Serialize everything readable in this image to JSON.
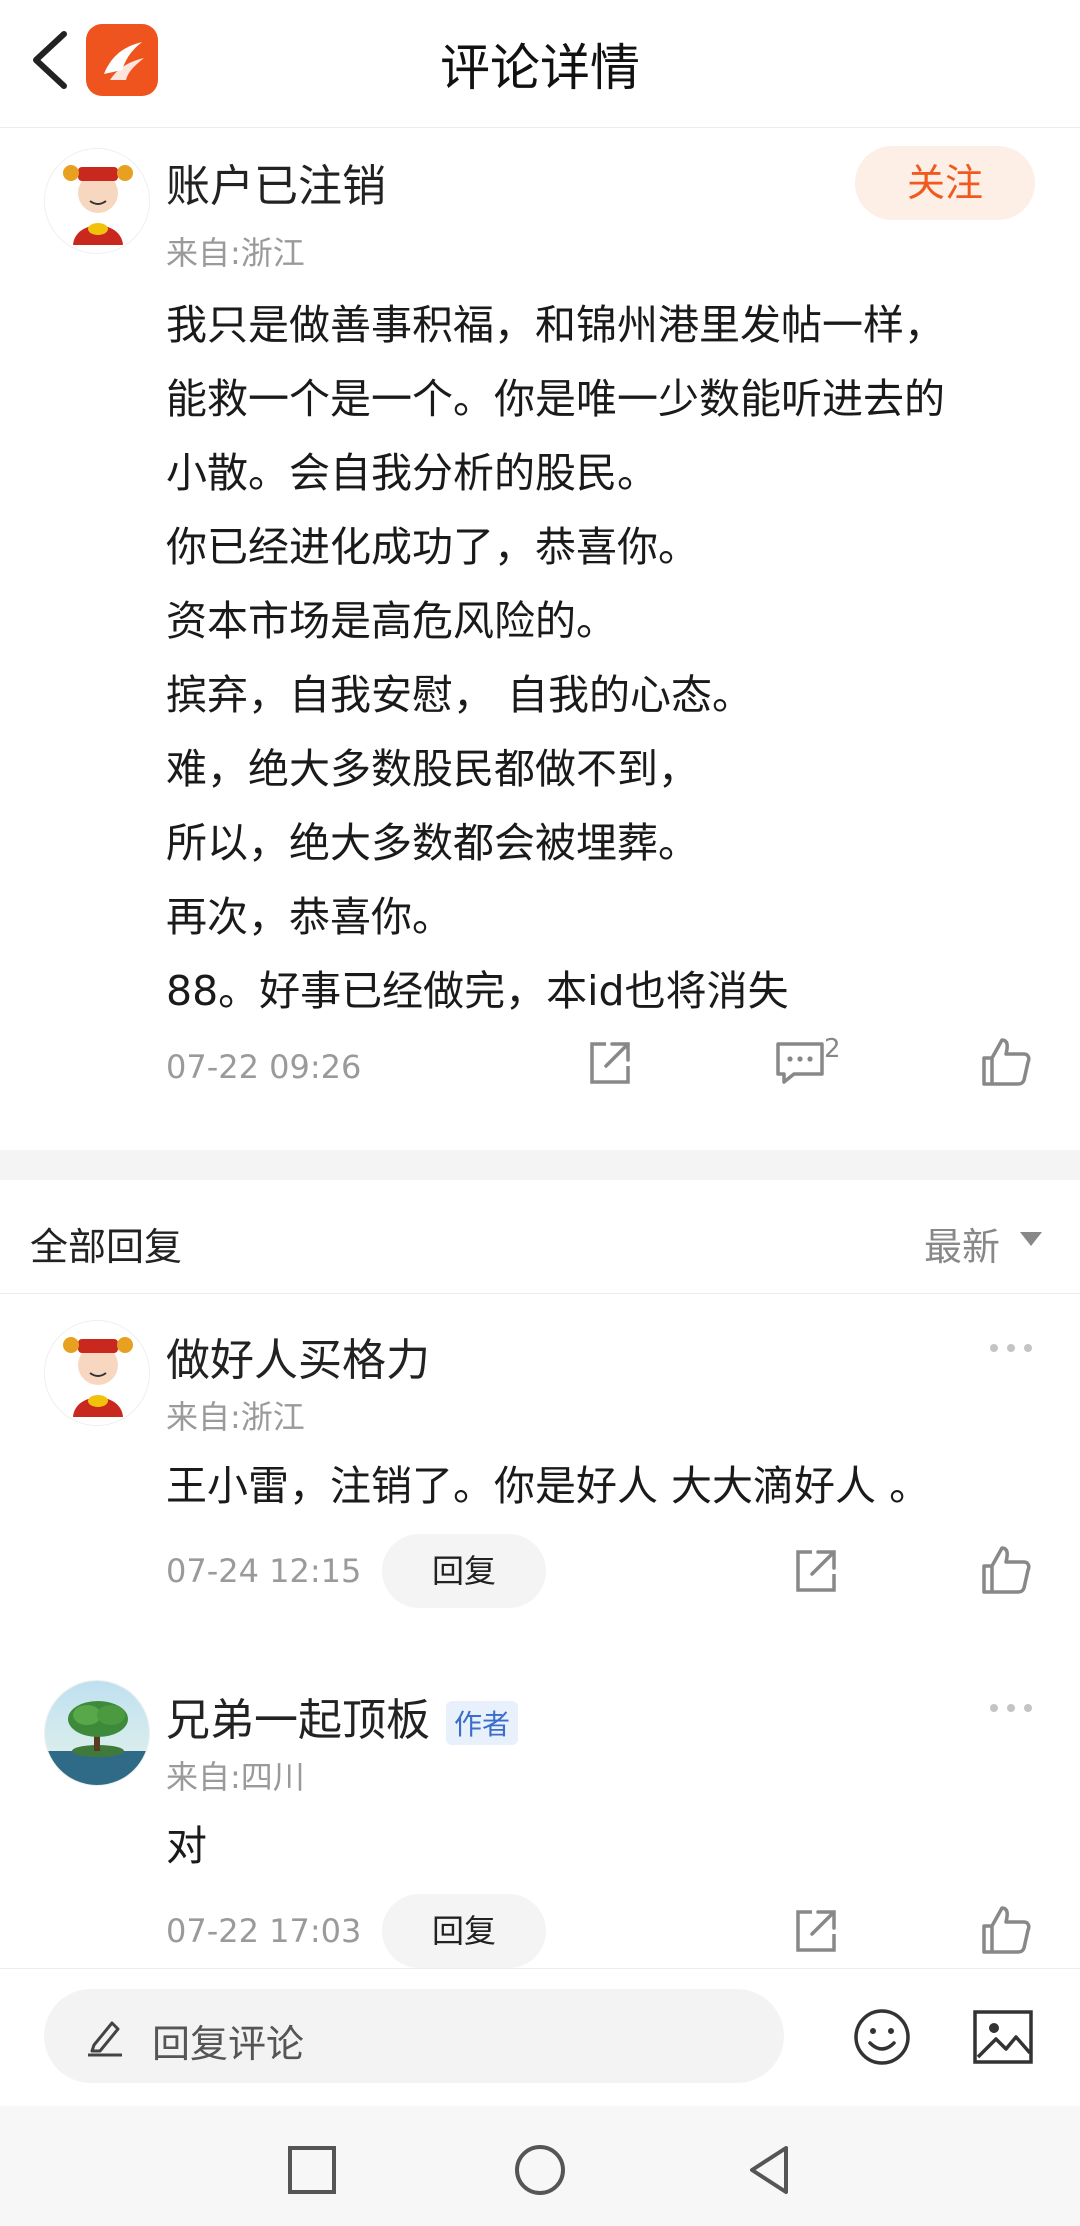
{
  "header": {
    "title": "评论详情"
  },
  "main_comment": {
    "username": "账户已注销",
    "origin": "来自:浙江",
    "follow_label": "关注",
    "lines": [
      "我只是做善事积福，和锦州港里发帖一样，",
      "能救一个是一个。你是唯一少数能听进去的",
      "小散。会自我分析的股民。",
      "你已经进化成功了，恭喜你。",
      "资本市场是高危风险的。",
      "摈弃，自我安慰， 自我的心态。",
      "难，绝大多数股民都做不到，",
      "所以，绝大多数都会被埋葬。",
      "再次，恭喜你。",
      "88。好事已经做完，本id也将消失"
    ],
    "time": "07-22 09:26",
    "comment_count": "2"
  },
  "replies_header": {
    "title": "全部回复",
    "sort_label": "最新"
  },
  "replies": [
    {
      "username": "做好人买格力",
      "origin": "来自:浙江",
      "text": "王小雷，注销了。你是好人 大大滴好人 。",
      "time": "07-24 12:15",
      "reply_label": "回复"
    },
    {
      "username": "兄弟一起顶板",
      "author_tag": "作者",
      "origin": "来自:四川",
      "text": "对",
      "time": "07-22 17:03",
      "reply_label": "回复"
    }
  ],
  "bottom_bar": {
    "placeholder": "回复评论"
  },
  "colors": {
    "accent": "#f05a1e",
    "follow_bg": "#fdeee6",
    "author_tag": "#3a6ec8"
  },
  "icons": [
    "back-icon",
    "app-logo-icon",
    "share-icon",
    "comment-icon",
    "like-icon",
    "more-icon",
    "pen-icon",
    "emoji-icon",
    "image-icon",
    "nav-square-icon",
    "nav-circle-icon",
    "nav-back-icon"
  ]
}
